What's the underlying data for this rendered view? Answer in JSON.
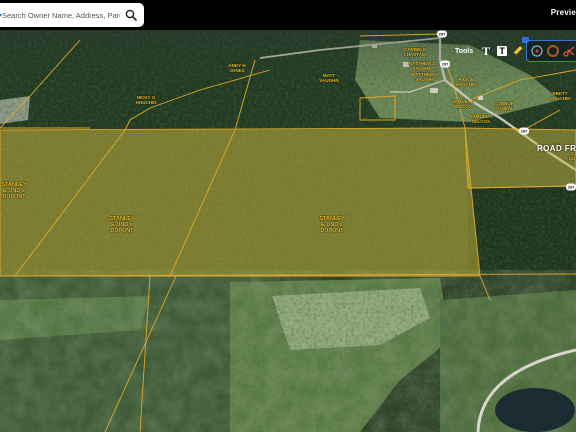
{
  "search": {
    "placeholder": "Search Owner Name, Address, Parcel Id"
  },
  "header": {
    "preview_label": "Previe"
  },
  "toolbar": {
    "tools_label": "Tools",
    "text_tool_glyph": "T",
    "label_tool_glyph": "T"
  },
  "map": {
    "road_label": "ROAD FRON",
    "road_numbers": [
      "297",
      "297",
      "297",
      "297"
    ],
    "parcels": [
      "ANDY H\nJONES",
      "NICKY G\nHOUCHIN",
      "MATT\nVAUGHN",
      "CARRIE G\nCHASTAIN",
      "MATTHEW D\nVAUGHN",
      "MATTHEW D\nVAUGHN",
      "RICK E\nHOUCHIN",
      "SAMUEL T\nWILCOX",
      "CONNOR\nL ONEAL",
      "SAMUEL T\nWILCOX",
      "BRETT\nHOUCHIN",
      "STANLEY\nE UND s\nDUPONT",
      "STANLEY\nE UND s\nDUPONT",
      "STANLEY\nE UND s\nDUPONT",
      "S\nDU"
    ]
  },
  "colors": {
    "parcel_line": "#e0a92a",
    "highlight_fill": "#c9b83a",
    "brand_blue": "#1a73e8"
  }
}
